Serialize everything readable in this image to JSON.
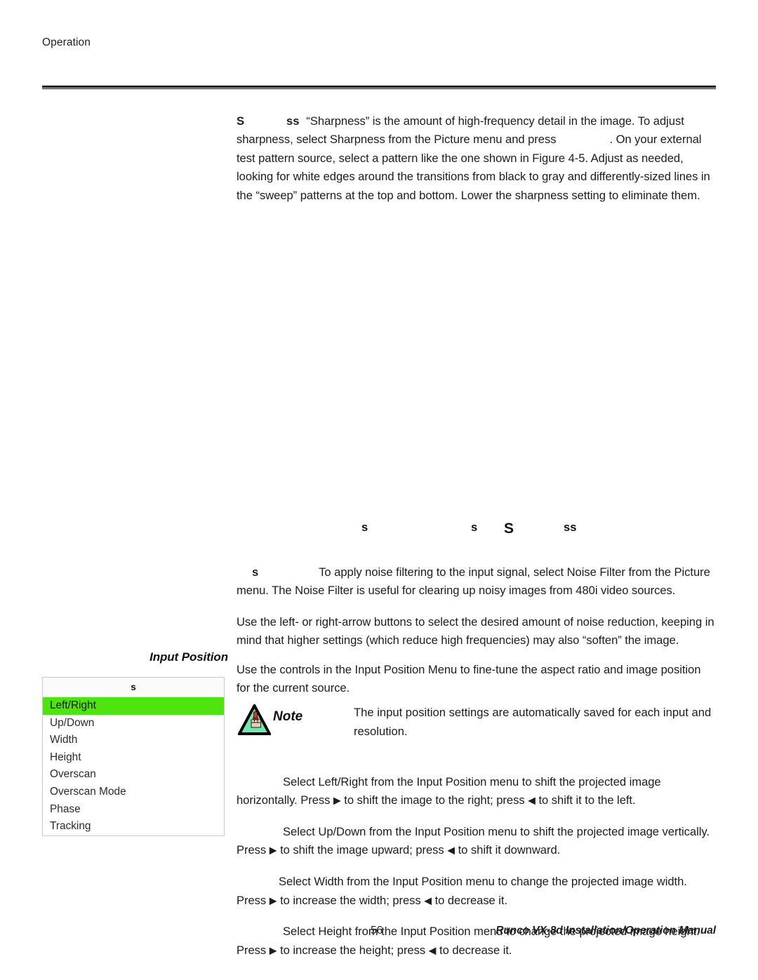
{
  "page": {
    "running_head": "Operation",
    "folio": "56",
    "footer_title": "Runco VX-8d Installation/Operation Manual"
  },
  "sharpness_section": {
    "run_in_glyph_1": "S",
    "run_in_glyph_2": "ss",
    "paragraph_part_1": "“Sharpness” is the amount of high-frequency detail in the image. To adjust sharpness, select Sharpness from the Picture menu and press",
    "paragraph_part_2": ". On your external test pattern source, select a pattern like the one shown in Figure 4-5. Adjust as needed, looking for white edges around the transitions from black to gray and differently-sized lines in the “sweep” patterns at the top and bottom. Lower the sharpness setting to eliminate them."
  },
  "figure": {
    "caption_glyph_a": "s",
    "caption_glyph_b": "s",
    "caption_glyph_c": "S",
    "caption_glyph_d": "ss"
  },
  "noise_filter_section": {
    "run_in_glyph": "s",
    "paragraph_1": "To apply noise filtering to the input signal, select Noise Filter from the Picture menu. The Noise Filter is useful for clearing up noisy images from 480i video sources.",
    "paragraph_2": "Use the left- or right-arrow buttons to select the desired amount of noise reduction, keeping in mind that higher settings (which reduce high frequencies) may also “soften” the image."
  },
  "input_position": {
    "margin_heading": "Input Position",
    "intro": "Use the controls in the Input Position Menu to fine-tune the aspect ratio and image position for the current source.",
    "menu": {
      "title_glyph": "s",
      "selected_index": 0,
      "highlight_color": "#4FE30F",
      "items": [
        "Left/Right",
        "Up/Down",
        "Width",
        "Height",
        "Overscan",
        "Overscan Mode",
        "Phase",
        "Tracking"
      ]
    },
    "note": {
      "label": "Note",
      "text": "The input position settings are automatically saved for each input and resolution."
    },
    "items_text": [
      {
        "part_1": "Select Left/Right from the Input Position menu to shift the projected image horizontally. Press",
        "arrow_1": "▶",
        "part_2": "to shift the image to the right; press",
        "arrow_2": "◀",
        "part_3": "to shift it to the left."
      },
      {
        "part_1": "Select Up/Down from the Input Position menu to shift the projected image vertically. Press",
        "arrow_1": "▶",
        "part_2": "to shift the image upward; press",
        "arrow_2": "◀",
        "part_3": "to shift it downward."
      },
      {
        "part_1": "Select Width from the Input Position menu to change the projected image width. Press",
        "arrow_1": "▶",
        "part_2": "to increase the width; press",
        "arrow_2": "◀",
        "part_3": "to decrease it."
      },
      {
        "part_1": "Select Height from the Input Position menu to change the projected image height. Press",
        "arrow_1": "▶",
        "part_2": "to increase the height; press",
        "arrow_2": "◀",
        "part_3": "to decrease it."
      }
    ]
  }
}
